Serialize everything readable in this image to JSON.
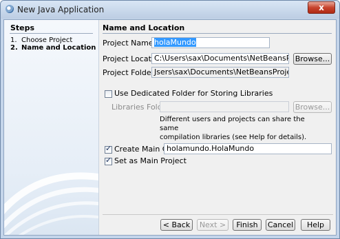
{
  "window": {
    "title": "New Java Application",
    "close_glyph": "x"
  },
  "steps": {
    "header": "Steps",
    "items": [
      {
        "num": "1.",
        "label": "Choose Project"
      },
      {
        "num": "2.",
        "label": "Name and Location"
      }
    ]
  },
  "panel": {
    "header": "Name and Location",
    "project_name": {
      "label": "Project Name:",
      "value": "holaMundo"
    },
    "project_location": {
      "label": "Project Location:",
      "value": "C:\\Users\\sax\\Documents\\NetBeansProjects",
      "browse": "Browse..."
    },
    "project_folder": {
      "label": "Project Folder:",
      "value": "Jsers\\sax\\Documents\\NetBeansProjects\\holaMundo"
    },
    "dedicated_folder": {
      "label": "Use Dedicated Folder for Storing Libraries",
      "checked": false
    },
    "libraries_folder": {
      "label": "Libraries Folder:",
      "value": "",
      "browse": "Browse..."
    },
    "hint_line1": "Different users and projects can share the same",
    "hint_line2": "compilation libraries (see Help for details).",
    "main_class": {
      "label": "Create Main Class",
      "checked": true,
      "value": "holamundo.HolaMundo"
    },
    "set_main": {
      "label": "Set as Main Project",
      "checked": true
    }
  },
  "buttons": {
    "back": "< Back",
    "next": "Next >",
    "finish": "Finish",
    "cancel": "Cancel",
    "help": "Help"
  },
  "colors": {
    "title_bar": "#c4d5ea",
    "selection": "#3399ff",
    "close_button": "#c7432d"
  }
}
